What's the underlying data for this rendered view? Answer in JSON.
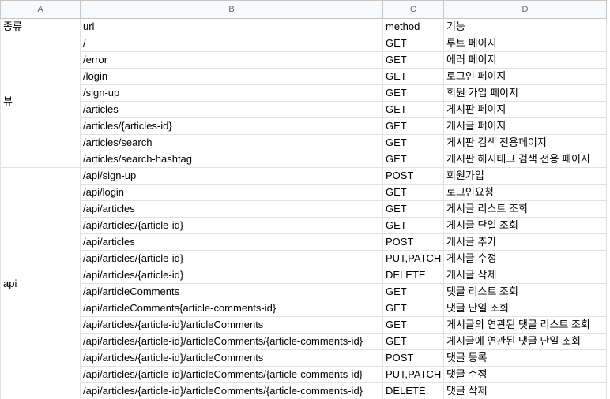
{
  "column_headers": [
    "A",
    "B",
    "C",
    "D"
  ],
  "header_row": [
    "종류",
    "url",
    "method",
    "기능"
  ],
  "groups": [
    {
      "label": "뷰",
      "rows": [
        [
          "/",
          "GET",
          "루트 페이지"
        ],
        [
          "/error",
          "GET",
          "에러 페이지"
        ],
        [
          "/login",
          "GET",
          "로그인 페이지"
        ],
        [
          "/sign-up",
          "GET",
          "회원 가입 페이지"
        ],
        [
          "/articles",
          "GET",
          "게시판 페이지"
        ],
        [
          "/articles/{articles-id}",
          "GET",
          "게시글 페이지"
        ],
        [
          "/articles/search",
          "GET",
          "게시판 검색 전용페이지"
        ],
        [
          "/articles/search-hashtag",
          "GET",
          "게시판 해시태그 검색 전용 페이지"
        ]
      ]
    },
    {
      "label": "api",
      "rows": [
        [
          "/api/sign-up",
          "POST",
          "회원가입"
        ],
        [
          "/api/login",
          "GET",
          "로그인요청"
        ],
        [
          "/api/articles",
          "GET",
          "게시글 리스트 조회"
        ],
        [
          "/api/articles/{article-id}",
          "GET",
          "게시글 단일 조회"
        ],
        [
          "/api/articles",
          "POST",
          "게시글 추가"
        ],
        [
          "/api/articles/{article-id}",
          "PUT,PATCH",
          "게시글 수정"
        ],
        [
          "/api/articles/{article-id}",
          "DELETE",
          "게시글 삭제"
        ],
        [
          "/api/articleComments",
          "GET",
          "댓글 리스트 조회"
        ],
        [
          "/api/articleComments{article-comments-id}",
          "GET",
          "댓글 단일 조회"
        ],
        [
          "/api/articles/{article-id}/articleComments",
          "GET",
          "게시글의 연관된 댓글 리스트 조회"
        ],
        [
          "/api/articles/{article-id}/articleComments/{article-comments-id}",
          "GET",
          "게시글에 연관된 댓글 단일 조회"
        ],
        [
          "/api/articles/{article-id}/articleComments",
          "POST",
          "댓글 등록"
        ],
        [
          "/api/articles/{article-id}/articleComments/{article-comments-id}",
          "PUT,PATCH",
          "댓글 수정"
        ],
        [
          "/api/articles/{article-id}/articleComments/{article-comments-id}",
          "DELETE",
          "댓글 삭제"
        ]
      ]
    }
  ]
}
